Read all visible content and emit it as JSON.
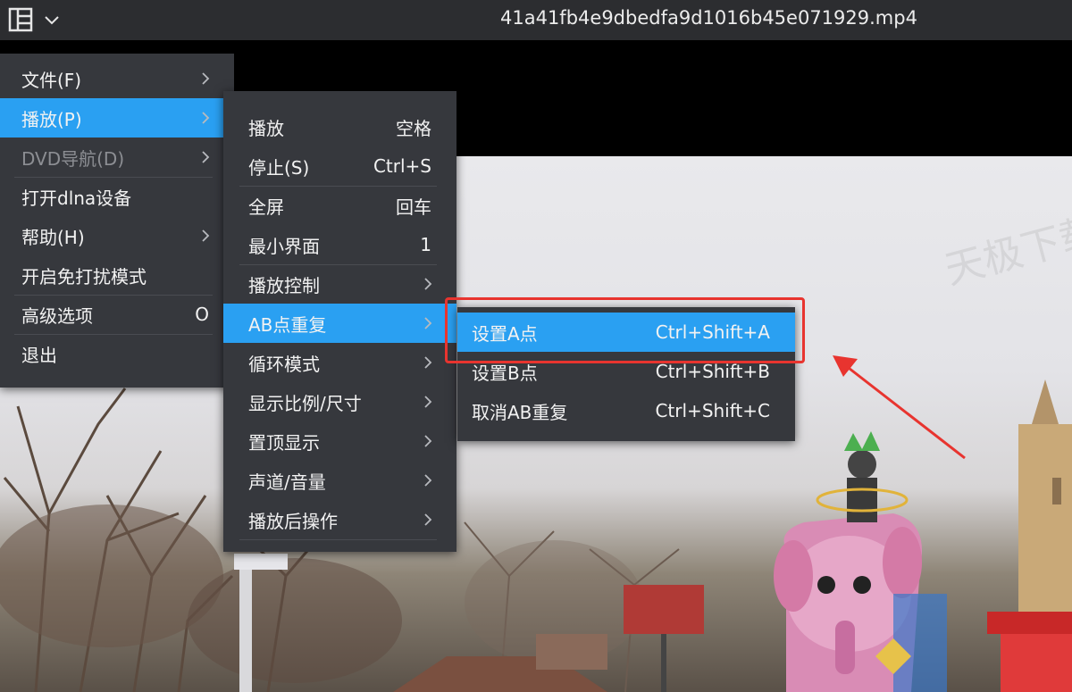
{
  "window": {
    "title": "41a41fb4e9dbedfa9d1016b45e071929.mp4",
    "menu_icon": "panel-layout-icon",
    "dropdown_icon": "chevron-down-icon"
  },
  "video": {
    "watermark": "天极下载"
  },
  "main_menu": {
    "items": [
      {
        "label": "文件(F)",
        "submenu": true,
        "state": "normal"
      },
      {
        "label": "播放(P)",
        "submenu": true,
        "state": "active"
      },
      {
        "label": "DVD导航(D)",
        "submenu": true,
        "state": "disabled"
      },
      {
        "label": "打开dlna设备",
        "submenu": false,
        "state": "normal"
      },
      {
        "label": "帮助(H)",
        "submenu": true,
        "state": "normal"
      },
      {
        "label": "开启免打扰模式",
        "submenu": false,
        "state": "normal"
      },
      {
        "label": "高级选项",
        "shortcut": "O",
        "state": "normal"
      },
      {
        "label": "退出",
        "state": "normal"
      }
    ]
  },
  "play_menu": {
    "items": [
      {
        "label": "播放",
        "shortcut": "空格"
      },
      {
        "label": "停止(S)",
        "shortcut": "Ctrl+S"
      },
      {
        "label": "全屏",
        "shortcut": "回车"
      },
      {
        "label": "最小界面",
        "shortcut": "1"
      },
      {
        "label": "播放控制",
        "submenu": true
      },
      {
        "label": "AB点重复",
        "submenu": true,
        "state": "active"
      },
      {
        "label": "循环模式",
        "submenu": true
      },
      {
        "label": "显示比例/尺寸",
        "submenu": true
      },
      {
        "label": "置顶显示",
        "submenu": true
      },
      {
        "label": "声道/音量",
        "submenu": true
      },
      {
        "label": "播放后操作",
        "submenu": true
      }
    ]
  },
  "ab_menu": {
    "items": [
      {
        "label": "设置A点",
        "shortcut": "Ctrl+Shift+A",
        "state": "active"
      },
      {
        "label": "设置B点",
        "shortcut": "Ctrl+Shift+B"
      },
      {
        "label": "取消AB重复",
        "shortcut": "Ctrl+Shift+C"
      }
    ]
  },
  "colors": {
    "menu_bg": "#36383d",
    "active_bg": "#2aa0f2",
    "highlight_border": "#e8342f",
    "titlebar_bg": "#2c2d30"
  }
}
